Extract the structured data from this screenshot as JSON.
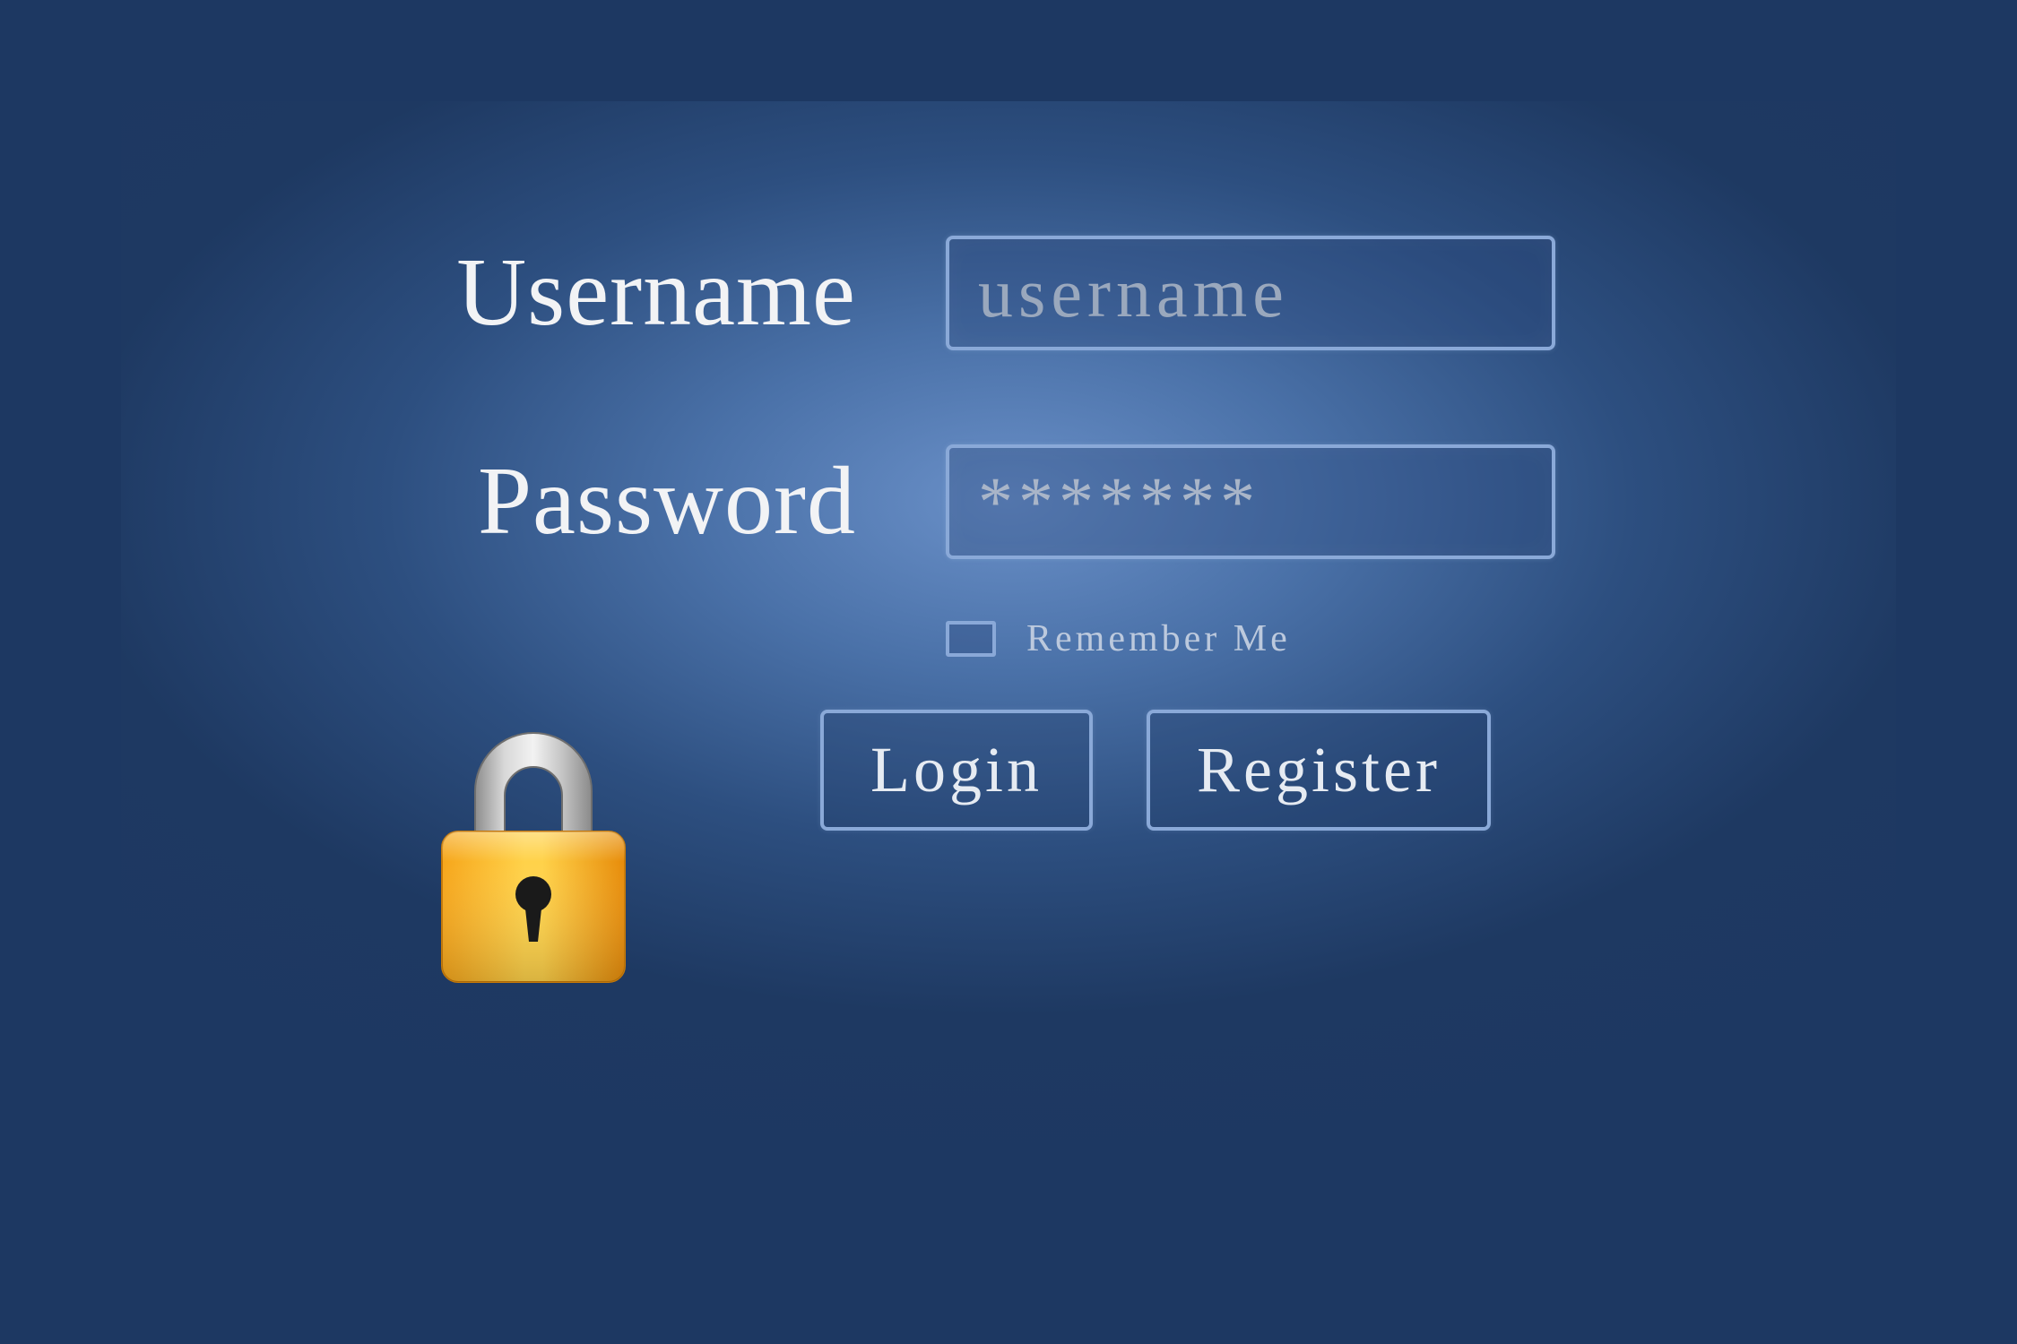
{
  "form": {
    "username_label": "Username",
    "password_label": "Password",
    "username_placeholder": "username",
    "password_value": "*******",
    "remember_label": "Remember Me",
    "login_label": "Login",
    "register_label": "Register"
  }
}
